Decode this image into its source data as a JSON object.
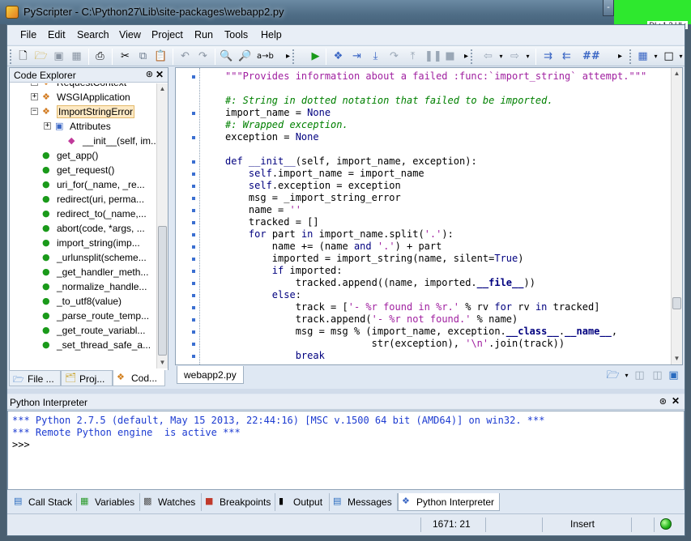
{
  "window": {
    "title": "PyScripter - C:\\Python27\\Lib\\site-packages\\webapp2.py",
    "min_label": "-"
  },
  "overlay": {
    "label": "DL: 1.3 UL:"
  },
  "menu": [
    "File",
    "Edit",
    "Search",
    "View",
    "Project",
    "Run",
    "Tools",
    "Help"
  ],
  "toolbar": {
    "icons": [
      "new-file",
      "open",
      "save",
      "save-all",
      "print",
      "cut",
      "copy",
      "paste",
      "undo",
      "redo",
      "find",
      "find-next",
      "replace",
      "run",
      "debug",
      "run-to-cursor",
      "step-into",
      "step-over",
      "step-out",
      "pause",
      "abort",
      "back",
      "forward",
      "indent",
      "unindent",
      "comment",
      "layout",
      "view"
    ]
  },
  "explorer": {
    "title": "Code Explorer",
    "items": [
      {
        "label": "RequestContext",
        "kind": "class",
        "expand": "+"
      },
      {
        "label": "WSGIApplication",
        "kind": "class",
        "expand": "+"
      },
      {
        "label": "ImportStringError",
        "kind": "class",
        "expand": "-",
        "selected": true
      },
      {
        "label": "Attributes",
        "kind": "attr",
        "expand": "+"
      },
      {
        "label": "__init__(self, im...",
        "kind": "method",
        "expand": ""
      },
      {
        "label": "get_app()",
        "kind": "func",
        "expand": ""
      },
      {
        "label": "get_request()",
        "kind": "func",
        "expand": ""
      },
      {
        "label": "uri_for(_name, _re...",
        "kind": "func",
        "expand": ""
      },
      {
        "label": "redirect(uri, perma...",
        "kind": "func",
        "expand": ""
      },
      {
        "label": "redirect_to(_name,...",
        "kind": "func",
        "expand": ""
      },
      {
        "label": "abort(code, *args, ...",
        "kind": "func",
        "expand": ""
      },
      {
        "label": "import_string(imp...",
        "kind": "func",
        "expand": ""
      },
      {
        "label": "_urlunsplit(scheme...",
        "kind": "func",
        "expand": ""
      },
      {
        "label": "_get_handler_meth...",
        "kind": "func",
        "expand": ""
      },
      {
        "label": "_normalize_handle...",
        "kind": "func",
        "expand": ""
      },
      {
        "label": "_to_utf8(value)",
        "kind": "func",
        "expand": ""
      },
      {
        "label": "_parse_route_temp...",
        "kind": "func",
        "expand": ""
      },
      {
        "label": "_get_route_variabl...",
        "kind": "func",
        "expand": ""
      },
      {
        "label": "_set_thread_safe_a...",
        "kind": "func",
        "expand": ""
      }
    ],
    "tabs": [
      "File ...",
      "Proj...",
      "Cod..."
    ]
  },
  "editor": {
    "tab": "webapp2.py",
    "lines": [
      [
        [
          "str",
          "\"\"\"Provides information about a failed :func:`import_string` attempt.\"\"\""
        ]
      ],
      [],
      [
        [
          "com",
          "#: String in dotted notation that failed to be imported."
        ]
      ],
      [
        [
          "txt",
          "import_name = "
        ],
        [
          "kw",
          "None"
        ]
      ],
      [
        [
          "com",
          "#: Wrapped exception."
        ]
      ],
      [
        [
          "txt",
          "exception = "
        ],
        [
          "kw",
          "None"
        ]
      ],
      [],
      [
        [
          "kw",
          "def "
        ],
        [
          "nm",
          "__init__"
        ],
        [
          "txt",
          "(self, import_name, exception):"
        ]
      ],
      [
        [
          "txt",
          "    "
        ],
        [
          "sf",
          "self"
        ],
        [
          "txt",
          ".import_name = import_name"
        ]
      ],
      [
        [
          "txt",
          "    "
        ],
        [
          "sf",
          "self"
        ],
        [
          "txt",
          ".exception = exception"
        ]
      ],
      [
        [
          "txt",
          "    msg = _import_string_error"
        ]
      ],
      [
        [
          "txt",
          "    name = "
        ],
        [
          "str",
          "''"
        ]
      ],
      [
        [
          "txt",
          "    tracked = []"
        ]
      ],
      [
        [
          "txt",
          "    "
        ],
        [
          "kw",
          "for"
        ],
        [
          "txt",
          " part "
        ],
        [
          "kw",
          "in"
        ],
        [
          "txt",
          " import_name.split("
        ],
        [
          "str",
          "'.'"
        ],
        [
          "txt",
          "):"
        ]
      ],
      [
        [
          "txt",
          "        name += (name "
        ],
        [
          "kw",
          "and"
        ],
        [
          "txt",
          " "
        ],
        [
          "str",
          "'.'"
        ],
        [
          "txt",
          ") + part"
        ]
      ],
      [
        [
          "txt",
          "        imported = import_string(name, silent="
        ],
        [
          "kw",
          "True"
        ],
        [
          "txt",
          ")"
        ]
      ],
      [
        [
          "txt",
          "        "
        ],
        [
          "kw",
          "if"
        ],
        [
          "txt",
          " imported:"
        ]
      ],
      [
        [
          "txt",
          "            tracked.append((name, imported."
        ],
        [
          "dund",
          "__file__"
        ],
        [
          "txt",
          "))"
        ]
      ],
      [
        [
          "txt",
          "        "
        ],
        [
          "kw",
          "else"
        ],
        [
          "txt",
          ":"
        ]
      ],
      [
        [
          "txt",
          "            track = ["
        ],
        [
          "str",
          "'- %r found in %r.'"
        ],
        [
          "txt",
          " % rv "
        ],
        [
          "kw",
          "for"
        ],
        [
          "txt",
          " rv "
        ],
        [
          "kw",
          "in"
        ],
        [
          "txt",
          " tracked]"
        ]
      ],
      [
        [
          "txt",
          "            track.append("
        ],
        [
          "str",
          "'- %r not found.'"
        ],
        [
          "txt",
          " % name)"
        ]
      ],
      [
        [
          "txt",
          "            msg = msg % (import_name, exception."
        ],
        [
          "dund",
          "__class__"
        ],
        [
          "txt",
          "."
        ],
        [
          "dund",
          "__name__"
        ],
        [
          "txt",
          ","
        ]
      ],
      [
        [
          "txt",
          "                         str(exception), "
        ],
        [
          "str",
          "'\\n'"
        ],
        [
          "txt",
          ".join(track))"
        ]
      ],
      [
        [
          "txt",
          "            "
        ],
        [
          "kw",
          "break"
        ]
      ]
    ],
    "markers": [
      0,
      3,
      5,
      7,
      8,
      9,
      10,
      11,
      12,
      13,
      14,
      15,
      16,
      17,
      18,
      19,
      20,
      21,
      22,
      23
    ]
  },
  "interpreter": {
    "title": "Python Interpreter",
    "lines": [
      "*** Python 2.7.5 (default, May 15 2013, 22:44:16) [MSC v.1500 64 bit (AMD64)] on win32. ***",
      "*** Remote Python engine  is active ***",
      ">>>"
    ]
  },
  "bottom_tabs": [
    "Call Stack",
    "Variables",
    "Watches",
    "Breakpoints",
    "Output",
    "Messages",
    "Python Interpreter"
  ],
  "status": {
    "position": "1671: 21",
    "mode": "Insert"
  }
}
